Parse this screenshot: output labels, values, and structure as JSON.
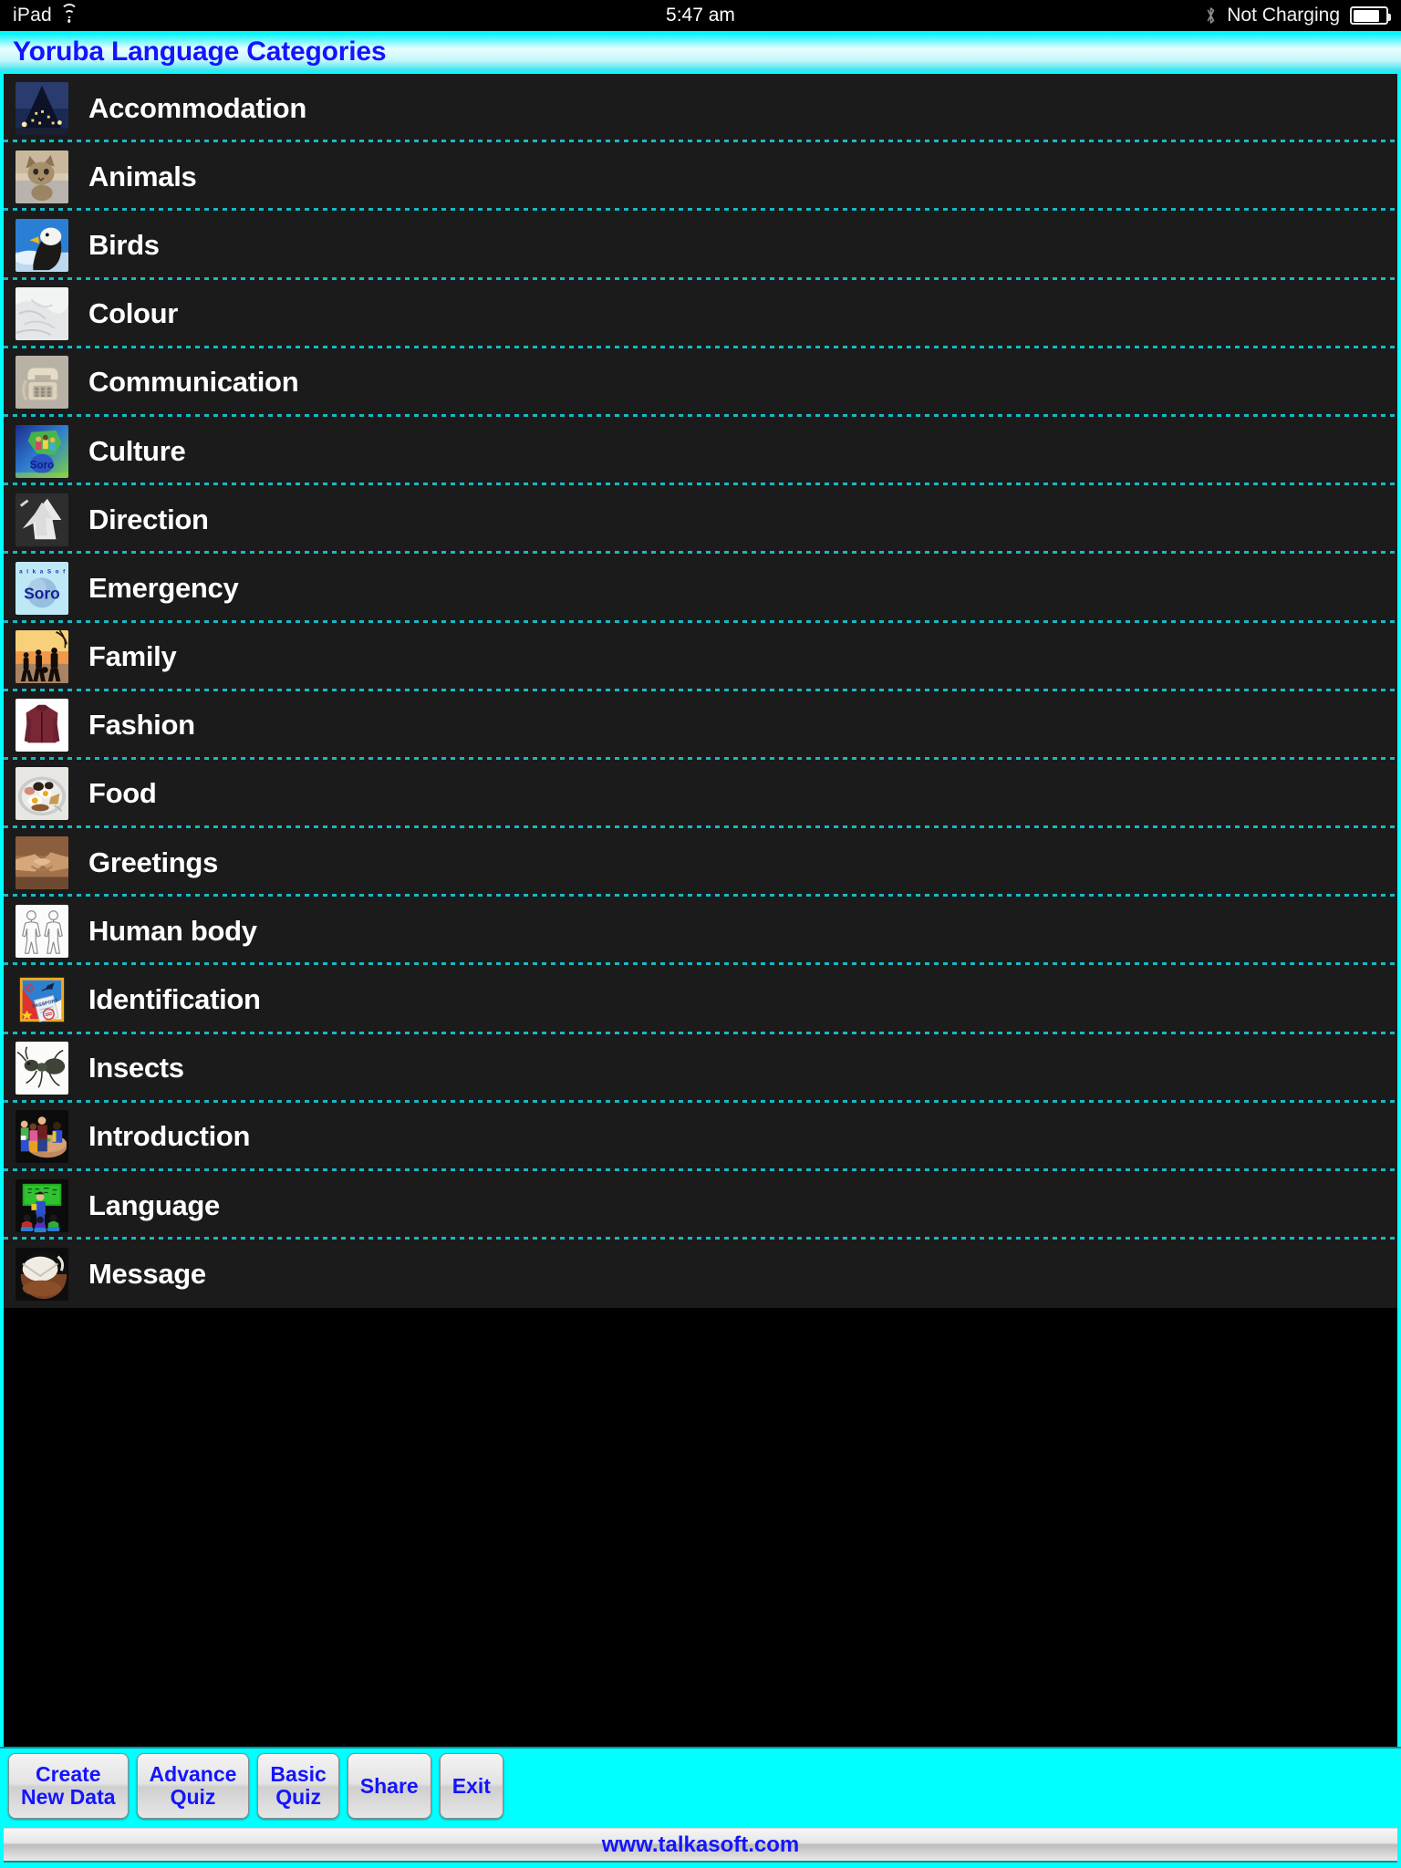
{
  "status_bar": {
    "device": "iPad",
    "wifi_icon": "wifi-icon",
    "time": "5:47 am",
    "bluetooth_icon": "bluetooth-icon",
    "battery_label": "Not Charging",
    "battery_icon": "battery-icon",
    "battery_level_pct": 76
  },
  "header": {
    "title": "Yoruba Language Categories",
    "title_color": "#1414ff",
    "accent_color": "#00ffff"
  },
  "list": {
    "items": [
      {
        "label": "Accommodation",
        "icon": "hotel-building-thumbnail"
      },
      {
        "label": "Animals",
        "icon": "cat-thumbnail"
      },
      {
        "label": "Birds",
        "icon": "eagle-thumbnail"
      },
      {
        "label": "Colour",
        "icon": "white-fabric-thumbnail"
      },
      {
        "label": "Communication",
        "icon": "telephone-thumbnail"
      },
      {
        "label": "Culture",
        "icon": "soro-culture-thumbnail"
      },
      {
        "label": "Direction",
        "icon": "arrow-road-marking-thumbnail"
      },
      {
        "label": "Emergency",
        "icon": "talkasoft-soro-logo-thumbnail"
      },
      {
        "label": "Family",
        "icon": "family-silhouette-sunset-thumbnail"
      },
      {
        "label": "Fashion",
        "icon": "leather-jacket-thumbnail"
      },
      {
        "label": "Food",
        "icon": "breakfast-plate-thumbnail"
      },
      {
        "label": "Greetings",
        "icon": "handshake-thumbnail"
      },
      {
        "label": "Human body",
        "icon": "human-body-diagram-thumbnail"
      },
      {
        "label": "Identification",
        "icon": "passport-stamp-thumbnail"
      },
      {
        "label": "Insects",
        "icon": "ant-thumbnail"
      },
      {
        "label": "Introduction",
        "icon": "people-meeting-thumbnail"
      },
      {
        "label": "Language",
        "icon": "teacher-classroom-thumbnail"
      },
      {
        "label": "Message",
        "icon": "envelope-pen-thumbnail"
      }
    ]
  },
  "toolbar": {
    "buttons": [
      {
        "label": "Create\nNew Data",
        "name": "create-new-data-button"
      },
      {
        "label": "Advance\nQuiz",
        "name": "advance-quiz-button"
      },
      {
        "label": "Basic\nQuiz",
        "name": "basic-quiz-button"
      },
      {
        "label": "Share",
        "name": "share-button"
      },
      {
        "label": "Exit",
        "name": "exit-button"
      }
    ]
  },
  "footer": {
    "website": "www.talkasoft.com"
  }
}
